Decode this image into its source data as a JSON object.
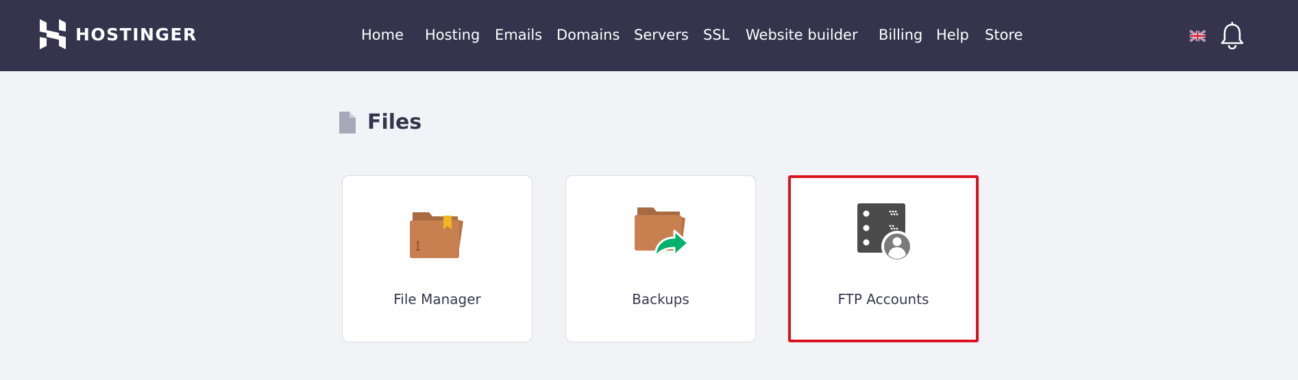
{
  "header": {
    "brand": "HOSTINGER",
    "nav": [
      {
        "label": "Home"
      },
      {
        "label": "Hosting"
      },
      {
        "label": "Emails"
      },
      {
        "label": "Domains"
      },
      {
        "label": "Servers"
      },
      {
        "label": "SSL"
      },
      {
        "label": "Website builder"
      },
      {
        "label": "Billing"
      },
      {
        "label": "Help"
      },
      {
        "label": "Store"
      }
    ],
    "language_icon": "uk-flag-icon",
    "notifications_icon": "bell-icon"
  },
  "section": {
    "icon": "file-icon",
    "title": "Files"
  },
  "cards": [
    {
      "label": "File Manager",
      "icon": "folder-bookmark-icon"
    },
    {
      "label": "Backups",
      "icon": "folder-share-arrow-icon"
    },
    {
      "label": "FTP Accounts",
      "icon": "ftp-server-user-icon",
      "highlighted": true
    }
  ],
  "colors": {
    "header_bg": "#36344d",
    "page_bg": "#f2f3f7",
    "highlight_border": "#d9121c",
    "folder": "#c98050",
    "backup_arrow": "#00b06b"
  }
}
